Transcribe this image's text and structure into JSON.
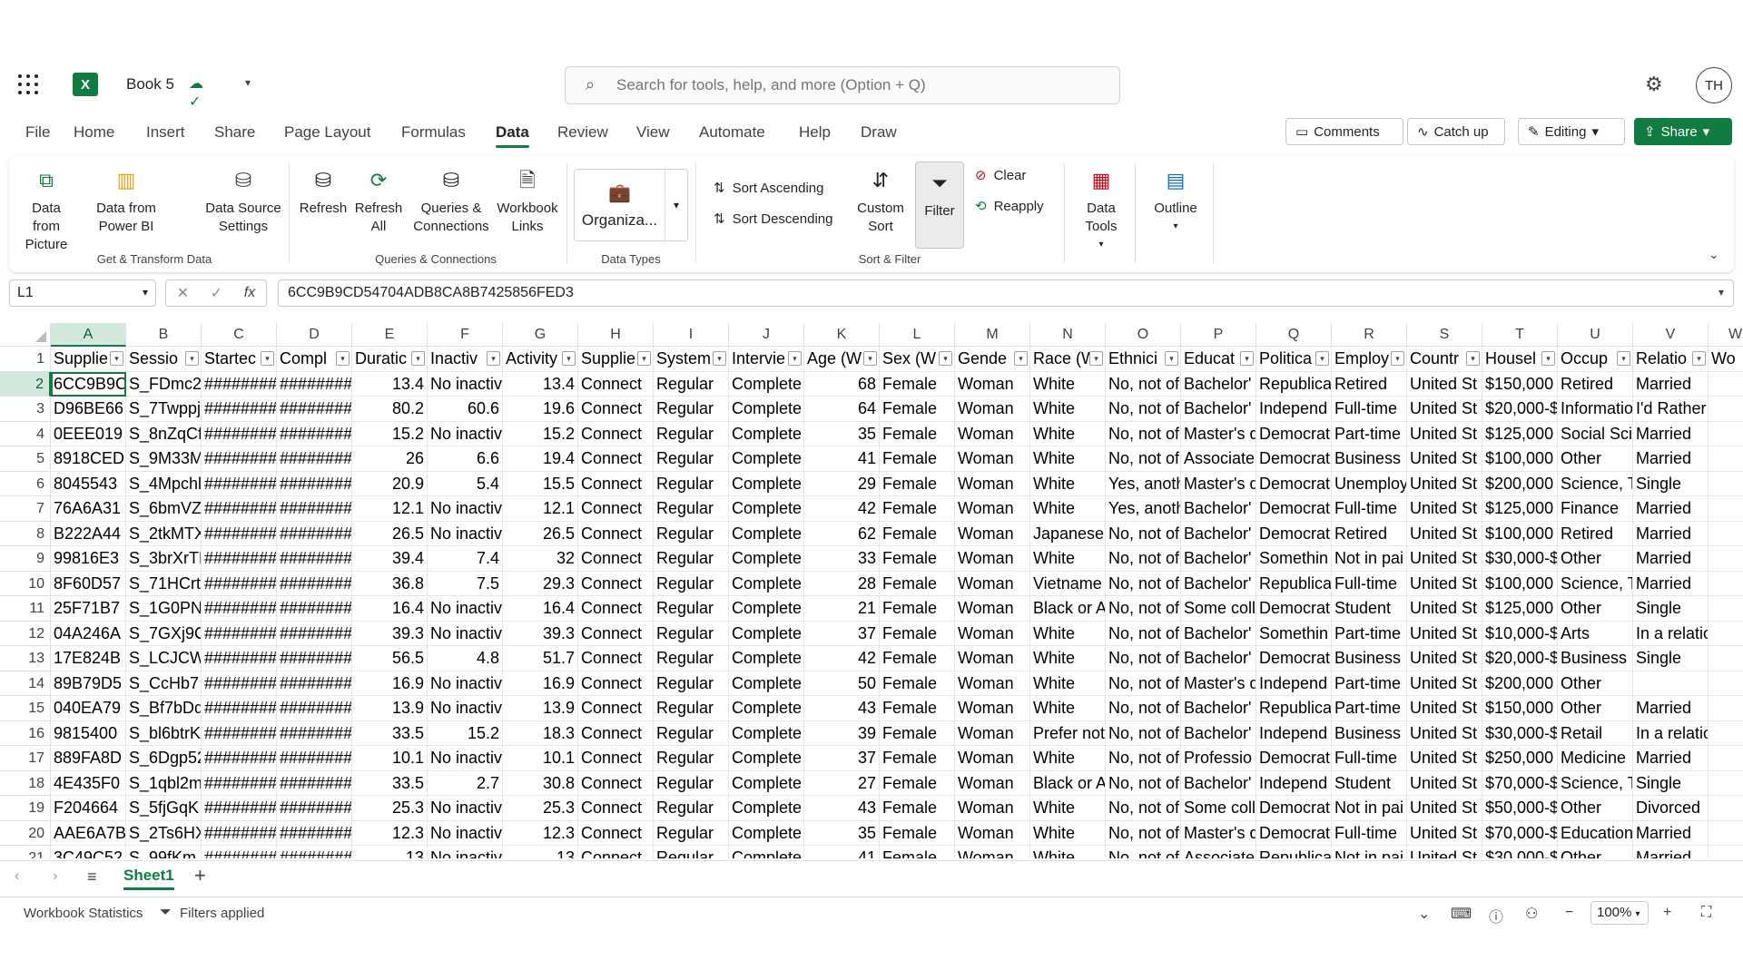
{
  "app": {
    "title": "Book 5",
    "logo": "X",
    "user_initials": "TH",
    "accent": "#107c41"
  },
  "search": {
    "placeholder": "Search for tools, help, and more (Option + Q)"
  },
  "menu": {
    "tabs": [
      "File",
      "Home",
      "Insert",
      "Share",
      "Page Layout",
      "Formulas",
      "Data",
      "Review",
      "View",
      "Automate",
      "Help",
      "Draw"
    ],
    "active": "Data",
    "comments": "Comments",
    "catch_up": "Catch up",
    "editing": "Editing",
    "share": "Share"
  },
  "ribbon": {
    "data_from_picture": "Data from Picture",
    "data_from_powerbi": "Data from Power BI",
    "data_source_settings": "Data Source Settings",
    "group_get_transform": "Get & Transform Data",
    "refresh": "Refresh",
    "refresh_all": "Refresh All",
    "queries_connections": "Queries & Connections",
    "workbook_links": "Workbook Links",
    "group_queries": "Queries & Connections",
    "data_type": "Organiza...",
    "group_data_types": "Data Types",
    "sort_ascending": "Sort Ascending",
    "sort_descending": "Sort Descending",
    "custom_sort": "Custom Sort",
    "filter": "Filter",
    "clear": "Clear",
    "reapply": "Reapply",
    "group_sort_filter": "Sort & Filter",
    "data_tools": "Data Tools",
    "outline": "Outline"
  },
  "formula_bar": {
    "name_box": "L1",
    "value": "6CC9B9CD54704ADB8CA8B7425856FED3"
  },
  "columns": [
    "A",
    "B",
    "C",
    "D",
    "E",
    "F",
    "G",
    "H",
    "I",
    "J",
    "K",
    "L",
    "M",
    "N",
    "O",
    "P",
    "Q",
    "R",
    "S",
    "T",
    "U",
    "V",
    "W"
  ],
  "header_row": [
    "Supplie",
    "Sessio",
    "Startec",
    "Compl",
    "Duratic",
    "Inactiv",
    "Activity",
    "Supplie",
    "System",
    "Intervie",
    "Age (W",
    "Sex (W",
    "Gende",
    "Race (W",
    "Ethnici",
    "Educat",
    "Politica",
    "Employ",
    "Countr",
    "Housel",
    "Occup",
    "Relatio",
    "Wo"
  ],
  "rows": [
    [
      "6CC9B9C",
      "S_FDmc2",
      "########",
      "########",
      "13.4",
      "No inactiv",
      "13.4",
      "Connect",
      "Regular",
      "Complete",
      "68",
      "Female",
      "Woman",
      "White",
      "No, not of",
      "Bachelor'",
      "Republica",
      "Retired",
      "United St",
      "$150,000",
      "Retired",
      "Married",
      ""
    ],
    [
      "D96BE66",
      "S_7Twppj",
      "########",
      "########",
      "80.2",
      "60.6",
      "19.6",
      "Connect",
      "Regular",
      "Complete",
      "64",
      "Female",
      "Woman",
      "White",
      "No, not of",
      "Bachelor'",
      "Independ",
      "Full-time",
      "United St",
      "$20,000-$",
      "Informatio",
      "I'd Rather",
      ""
    ],
    [
      "0EEE019",
      "S_8nZqCf",
      "########",
      "########",
      "15.2",
      "No inactiv",
      "15.2",
      "Connect",
      "Regular",
      "Complete",
      "35",
      "Female",
      "Woman",
      "White",
      "No, not of",
      "Master's d",
      "Democrat",
      "Part-time",
      "United St",
      "$125,000",
      "Social Sci",
      "Married",
      ""
    ],
    [
      "8918CED",
      "S_9M33M",
      "########",
      "########",
      "26",
      "6.6",
      "19.4",
      "Connect",
      "Regular",
      "Complete",
      "41",
      "Female",
      "Woman",
      "White",
      "No, not of",
      "Associate",
      "Democrat",
      "Business",
      "United St",
      "$100,000",
      "Other",
      "Married",
      ""
    ],
    [
      "8045543",
      "S_4Mpchl",
      "########",
      "########",
      "20.9",
      "5.4",
      "15.5",
      "Connect",
      "Regular",
      "Complete",
      "29",
      "Female",
      "Woman",
      "White",
      "Yes, anoth",
      "Master's d",
      "Democrat",
      "Unemploy",
      "United St",
      "$200,000",
      "Science, T",
      "Single",
      ""
    ],
    [
      "76A6A31",
      "S_6bmVZ",
      "########",
      "########",
      "12.1",
      "No inactiv",
      "12.1",
      "Connect",
      "Regular",
      "Complete",
      "42",
      "Female",
      "Woman",
      "White",
      "Yes, anoth",
      "Bachelor'",
      "Democrat",
      "Full-time",
      "United St",
      "$125,000",
      "Finance",
      "Married",
      ""
    ],
    [
      "B222A44",
      "S_2tkMTX",
      "########",
      "########",
      "26.5",
      "No inactiv",
      "26.5",
      "Connect",
      "Regular",
      "Complete",
      "62",
      "Female",
      "Woman",
      "Japanese",
      "No, not of",
      "Bachelor'",
      "Democrat",
      "Retired",
      "United St",
      "$100,000",
      "Retired",
      "Married",
      ""
    ],
    [
      "99816E3",
      "S_3brXrTN",
      "########",
      "########",
      "39.4",
      "7.4",
      "32",
      "Connect",
      "Regular",
      "Complete",
      "33",
      "Female",
      "Woman",
      "White",
      "No, not of",
      "Bachelor'",
      "Somethin",
      "Not in pai",
      "United St",
      "$30,000-$",
      "Other",
      "Married",
      ""
    ],
    [
      "8F60D57",
      "S_71HCrt",
      "########",
      "########",
      "36.8",
      "7.5",
      "29.3",
      "Connect",
      "Regular",
      "Complete",
      "28",
      "Female",
      "Woman",
      "Vietname",
      "No, not of",
      "Bachelor'",
      "Republica",
      "Full-time",
      "United St",
      "$100,000",
      "Science, T",
      "Married",
      ""
    ],
    [
      "25F71B7",
      "S_1G0PN",
      "########",
      "########",
      "16.4",
      "No inactiv",
      "16.4",
      "Connect",
      "Regular",
      "Complete",
      "21",
      "Female",
      "Woman",
      "Black or A",
      "No, not of",
      "Some coll",
      "Democrat",
      "Student",
      "United St",
      "$125,000",
      "Other",
      "Single",
      ""
    ],
    [
      "04A246A",
      "S_7GXj9C",
      "########",
      "########",
      "39.3",
      "No inactiv",
      "39.3",
      "Connect",
      "Regular",
      "Complete",
      "37",
      "Female",
      "Woman",
      "White",
      "No, not of",
      "Bachelor'",
      "Somethin",
      "Part-time",
      "United St",
      "$10,000-$",
      "Arts",
      "In a relatio",
      ""
    ],
    [
      "17E824B",
      "S_LCJCW",
      "########",
      "########",
      "56.5",
      "4.8",
      "51.7",
      "Connect",
      "Regular",
      "Complete",
      "42",
      "Female",
      "Woman",
      "White",
      "No, not of",
      "Bachelor'",
      "Democrat",
      "Business",
      "United St",
      "$20,000-$",
      "Business",
      "Single",
      ""
    ],
    [
      "89B79D5",
      "S_CcHb7",
      "########",
      "########",
      "16.9",
      "No inactiv",
      "16.9",
      "Connect",
      "Regular",
      "Complete",
      "50",
      "Female",
      "Woman",
      "White",
      "No, not of",
      "Master's d",
      "Independ",
      "Part-time",
      "United St",
      "$200,000",
      "Other",
      "",
      ""
    ],
    [
      "040EA79",
      "S_Bf7bDq",
      "########",
      "########",
      "13.9",
      "No inactiv",
      "13.9",
      "Connect",
      "Regular",
      "Complete",
      "43",
      "Female",
      "Woman",
      "White",
      "No, not of",
      "Bachelor'",
      "Republica",
      "Part-time",
      "United St",
      "$150,000",
      "Other",
      "Married",
      ""
    ],
    [
      "9815400",
      "S_bl6btrK",
      "########",
      "########",
      "33.5",
      "15.2",
      "18.3",
      "Connect",
      "Regular",
      "Complete",
      "39",
      "Female",
      "Woman",
      "Prefer not",
      "No, not of",
      "Bachelor'",
      "Independ",
      "Business",
      "United St",
      "$30,000-$",
      "Retail",
      "In a relatio",
      ""
    ],
    [
      "889FA8D",
      "S_6Dgp52",
      "########",
      "########",
      "10.1",
      "No inactiv",
      "10.1",
      "Connect",
      "Regular",
      "Complete",
      "37",
      "Female",
      "Woman",
      "White",
      "No, not of",
      "Professio",
      "Democrat",
      "Full-time",
      "United St",
      "$250,000",
      "Medicine",
      "Married",
      ""
    ],
    [
      "4E435F0",
      "S_1qbl2m",
      "########",
      "########",
      "33.5",
      "2.7",
      "30.8",
      "Connect",
      "Regular",
      "Complete",
      "27",
      "Female",
      "Woman",
      "Black or A",
      "No, not of",
      "Bachelor'",
      "Independ",
      "Student",
      "United St",
      "$70,000-$",
      "Science, T",
      "Single",
      ""
    ],
    [
      "F204664",
      "S_5fjGqK",
      "########",
      "########",
      "25.3",
      "No inactiv",
      "25.3",
      "Connect",
      "Regular",
      "Complete",
      "43",
      "Female",
      "Woman",
      "White",
      "No, not of",
      "Some coll",
      "Democrat",
      "Not in pai",
      "United St",
      "$50,000-$",
      "Other",
      "Divorced",
      ""
    ],
    [
      "AAE6A7B",
      "S_2Ts6HX",
      "########",
      "########",
      "12.3",
      "No inactiv",
      "12.3",
      "Connect",
      "Regular",
      "Complete",
      "35",
      "Female",
      "Woman",
      "White",
      "No, not of",
      "Master's d",
      "Democrat",
      "Full-time",
      "United St",
      "$70,000-$",
      "Education",
      "Married",
      ""
    ],
    [
      "3C49C52",
      "S_99fKm",
      "########",
      "########",
      "13",
      "No inactiv",
      "13",
      "Connect",
      "Regular",
      "Complete",
      "41",
      "Female",
      "Woman",
      "White",
      "No, not of",
      "Associate",
      "Republica",
      "Not in pai",
      "United St",
      "$30,000-$",
      "Other",
      "Married",
      ""
    ]
  ],
  "row_numbers": [
    "1",
    "2",
    "3",
    "4",
    "5",
    "6",
    "7",
    "8",
    "9",
    "10",
    "11",
    "12",
    "13",
    "14",
    "15",
    "16",
    "17",
    "18",
    "19",
    "20",
    "21"
  ],
  "sheets": {
    "active": "Sheet1"
  },
  "status": {
    "workbook_statistics": "Workbook Statistics",
    "filters_applied": "Filters applied",
    "zoom": "100%"
  }
}
